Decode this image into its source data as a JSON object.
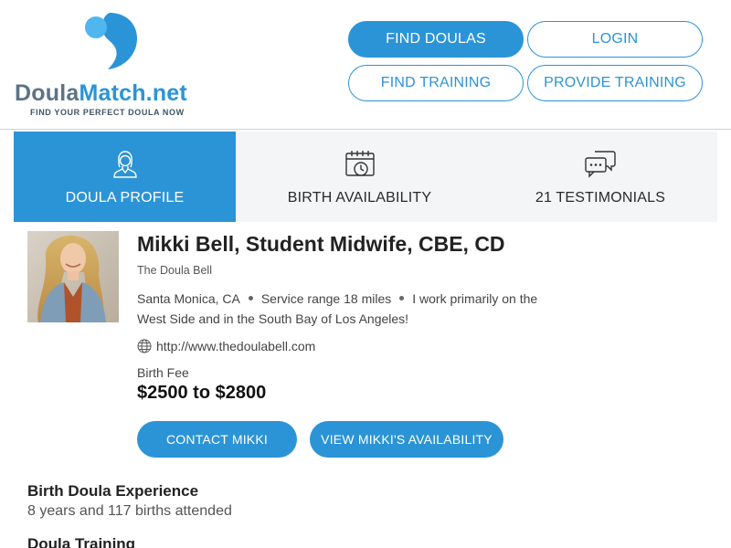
{
  "brand": {
    "name_part1": "Doula",
    "name_part2": "Match.net",
    "tagline": "FIND YOUR PERFECT DOULA NOW",
    "colors": {
      "accent": "#2b94d6",
      "light_accent": "#4fb6ee",
      "text_gray": "#5d7384"
    }
  },
  "nav": {
    "find_doulas": "FIND DOULAS",
    "login": "LOGIN",
    "find_training": "FIND TRAINING",
    "provide_training": "PROVIDE TRAINING"
  },
  "tabs": [
    {
      "label": "DOULA PROFILE",
      "icon": "person-icon",
      "active": true
    },
    {
      "label": "BIRTH AVAILABILITY",
      "icon": "calendar-clock-icon",
      "active": false
    },
    {
      "label": "21 TESTIMONIALS",
      "icon": "chat-bubbles-icon",
      "active": false
    }
  ],
  "profile": {
    "name": "Mikki Bell, Student Midwife, CBE, CD",
    "business": "The Doula Bell",
    "location": "Santa Monica, CA",
    "service_range": "Service range 18 miles",
    "area_note": "I work primarily on the West Side and in the South Bay of Los Angeles!",
    "website": "http://www.thedoulabell.com",
    "fee_label": "Birth Fee",
    "fee_value": "$2500 to $2800",
    "contact_button": "CONTACT MIKKI",
    "availability_button": "VIEW MIKKI'S AVAILABILITY"
  },
  "sections": {
    "experience_title": "Birth Doula Experience",
    "experience_text": "8 years and 117 births attended",
    "training_title": "Doula Training"
  }
}
